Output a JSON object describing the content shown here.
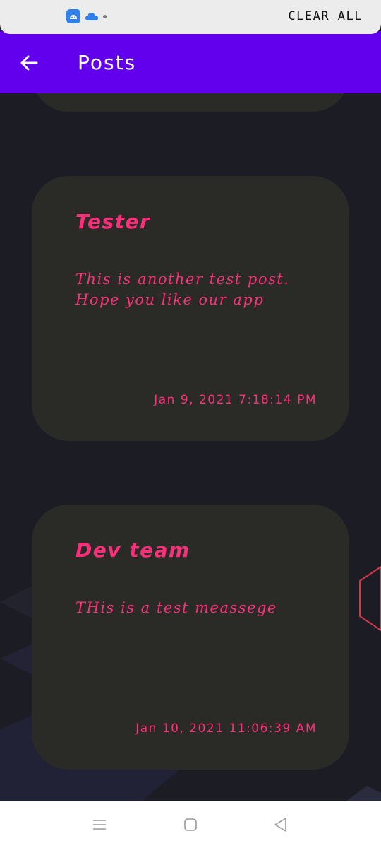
{
  "status": {
    "clear_all": "CLEAR ALL",
    "icons": [
      "android-app-icon",
      "cloud-icon",
      "more-dot-icon"
    ]
  },
  "appbar": {
    "title": "Posts",
    "back_icon": "arrow-left-icon",
    "color": "#6200ee"
  },
  "posts": [
    {
      "author": "Tester",
      "message": "This is another test post. Hope you like our app",
      "timestamp": "Jan 9, 2021 7:18:14 PM"
    },
    {
      "author": "Dev team",
      "message": "THis is a test meassege",
      "timestamp": "Jan 10, 2021 11:06:39 AM"
    }
  ],
  "colors": {
    "background": "#1c1d24",
    "card": "#2a2a26",
    "accent_text": "#ff2e7a"
  },
  "navbar": {
    "icons": [
      "recents-icon",
      "home-icon",
      "back-triangle-icon"
    ]
  }
}
